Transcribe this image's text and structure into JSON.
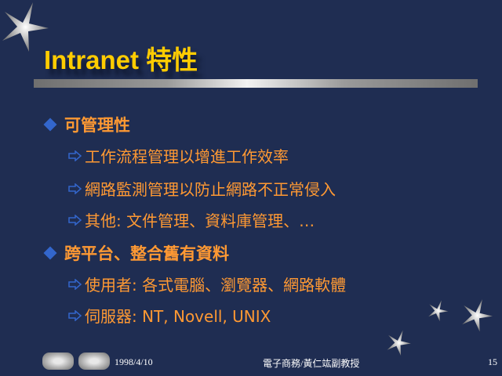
{
  "slide": {
    "title": "Intranet 特性"
  },
  "bullets": [
    {
      "text": "可管理性",
      "subs": [
        "工作流程管理以增進工作效率",
        "網路監測管理以防止網路不正常侵入",
        "其他: 文件管理、資料庫管理、…"
      ]
    },
    {
      "text": "跨平台、整合舊有資料",
      "subs": [
        "使用者: 各式電腦、瀏覽器、網路軟體",
        "伺服器: NT, Novell, UNIX"
      ]
    }
  ],
  "footer": {
    "date": "1998/4/10",
    "author": "電子商務/黃仁竑副教授",
    "page": "15"
  },
  "colors": {
    "background": "#1f2d52",
    "title": "#ffcc00",
    "body": "#ff9933",
    "bullet": "#3366cc"
  }
}
